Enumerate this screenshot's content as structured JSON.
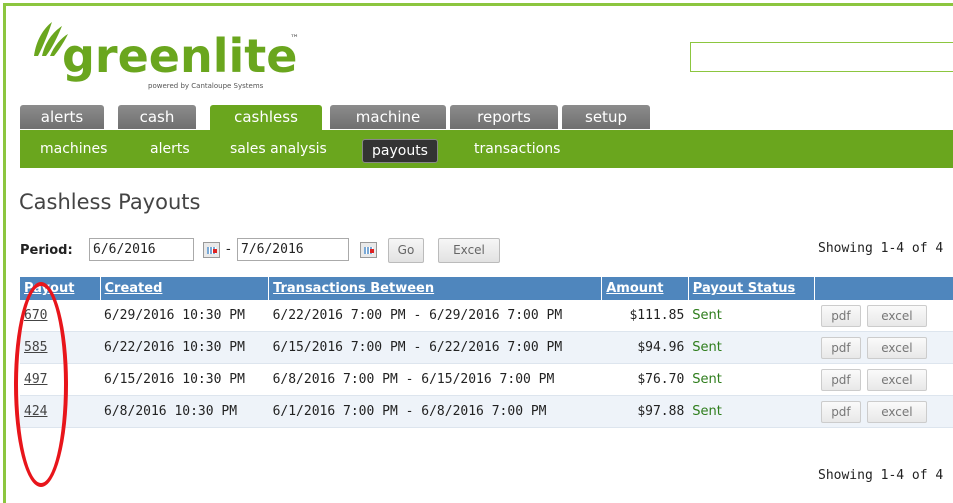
{
  "brand": {
    "logo_text": "greenlite",
    "tm": "™",
    "powered_by": "powered by Cantaloupe Systems",
    "accent_color": "#6aa61e",
    "header_color": "#4f86bd",
    "highlight_color": "#e8151b"
  },
  "tabs": [
    {
      "label": "alerts",
      "active": false
    },
    {
      "label": "cash",
      "active": false
    },
    {
      "label": "cashless",
      "active": true
    },
    {
      "label": "machine",
      "active": false
    },
    {
      "label": "reports",
      "active": false
    },
    {
      "label": "setup",
      "active": false
    }
  ],
  "subnav": [
    {
      "label": "machines",
      "active": false
    },
    {
      "label": "alerts",
      "active": false
    },
    {
      "label": "sales analysis",
      "active": false
    },
    {
      "label": "payouts",
      "active": true
    },
    {
      "label": "transactions",
      "active": false
    }
  ],
  "page_title": "Cashless Payouts",
  "filter": {
    "period_label": "Period:",
    "start_date": "6/6/2016",
    "separator": "-",
    "end_date": "7/6/2016",
    "go_label": "Go",
    "excel_label": "Excel"
  },
  "showing_text": "Showing 1-4 of 4",
  "table": {
    "headers": [
      "Payout",
      "Created",
      "Transactions Between",
      "Amount",
      "Payout Status",
      ""
    ],
    "rows": [
      {
        "payout": "670",
        "created": "6/29/2016 10:30 PM",
        "between": "6/22/2016 7:00 PM - 6/29/2016 7:00 PM",
        "amount": "$111.85",
        "status": "Sent",
        "pdf": "pdf",
        "excel": "excel"
      },
      {
        "payout": "585",
        "created": "6/22/2016 10:30 PM",
        "between": "6/15/2016 7:00 PM - 6/22/2016 7:00 PM",
        "amount": "$94.96",
        "status": "Sent",
        "pdf": "pdf",
        "excel": "excel"
      },
      {
        "payout": "497",
        "created": "6/15/2016 10:30 PM",
        "between": "6/8/2016 7:00 PM - 6/15/2016 7:00 PM",
        "amount": "$76.70",
        "status": "Sent",
        "pdf": "pdf",
        "excel": "excel"
      },
      {
        "payout": "424",
        "created": "6/8/2016 10:30 PM",
        "between": "6/1/2016 7:00 PM - 6/8/2016 7:00 PM",
        "amount": "$97.88",
        "status": "Sent",
        "pdf": "pdf",
        "excel": "excel"
      }
    ]
  }
}
